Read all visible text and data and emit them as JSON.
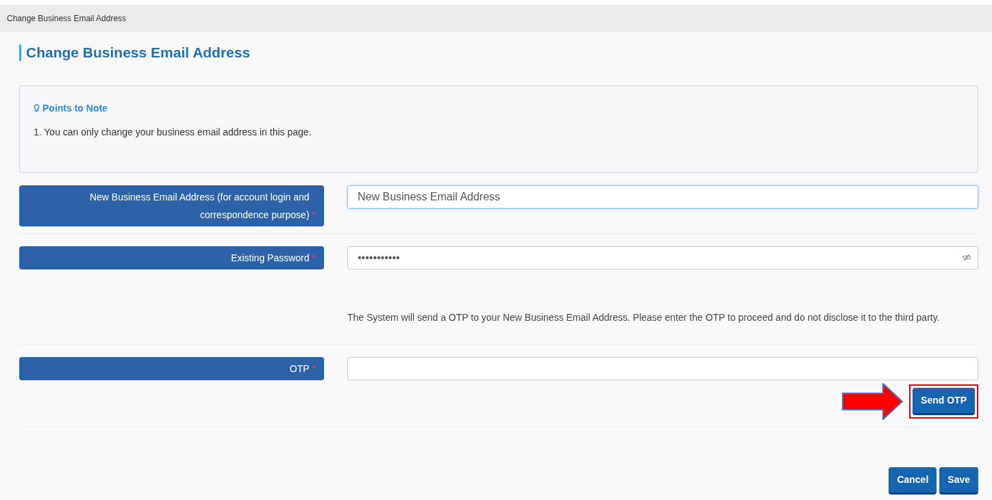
{
  "breadcrumb": "Change Business Email Address",
  "heading": "Change Business Email Address",
  "note": {
    "title": "Points to Note",
    "items": [
      "1. You can only change your business email address in this page."
    ]
  },
  "fields": [
    {
      "label": "New Business Email Address (for account login and correspondence purpose)",
      "required_mark": "*",
      "kind": "text",
      "placeholder": "New Business Email Address",
      "focused": true
    },
    {
      "label": "Existing Password",
      "required_mark": "*",
      "kind": "password",
      "value": "•••••••••••",
      "focused": false,
      "help": "The System will send a OTP to your New Business Email Address. Please enter the OTP to proceed and do not disclose it to the third party."
    },
    {
      "label": "OTP",
      "required_mark": "*",
      "kind": "otp",
      "focused": false,
      "button": "Send OTP",
      "highlighted": true
    }
  ],
  "buttons": [
    "Cancel",
    "Save"
  ]
}
